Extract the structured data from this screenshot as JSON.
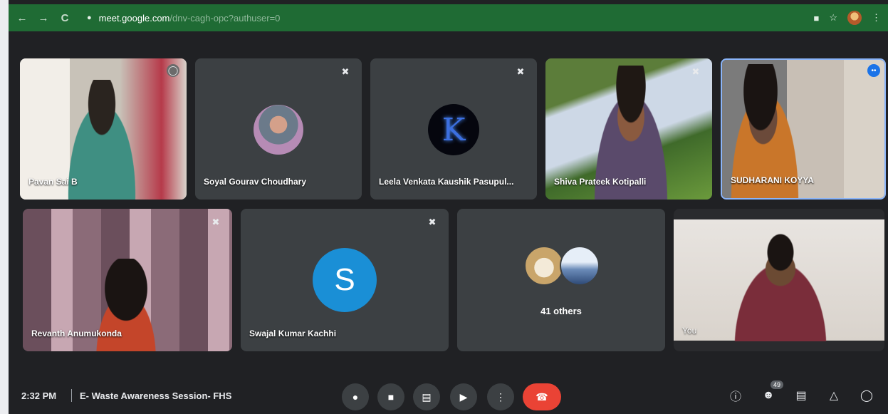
{
  "browser": {
    "back_icon": "back-arrow-icon",
    "forward_icon": "forward-arrow-icon",
    "reload_icon": "reload-icon",
    "url_host": "meet.google.com",
    "url_path": "/dnv-cagh-opc?authuser=0"
  },
  "participants": [
    {
      "name": "Pavan Sai B",
      "muted": true
    },
    {
      "name": "Soyal Gourav Choudhary",
      "muted": true
    },
    {
      "name": "Leela Venkata Kaushik Pasupul...",
      "muted": true,
      "avatar_letter": "K"
    },
    {
      "name": "Shiva Prateek Kotipalli",
      "muted": true
    },
    {
      "name": "SUDHARANI KOYYA",
      "muted": false,
      "speaking": true
    },
    {
      "name": "Revanth Anumukonda",
      "muted": true
    },
    {
      "name": "Swajal Kumar Kachhi",
      "muted": true,
      "avatar_letter": "S"
    },
    {
      "name": "41 others"
    },
    {
      "name": "You"
    }
  ],
  "bottom": {
    "time": "2:32 PM",
    "meeting_title": "E- Waste Awareness Session- FHS",
    "people_count": "49"
  },
  "colors": {
    "accent": "#1a73e8",
    "end_call": "#ea4335",
    "tile_bg": "#3c4043",
    "speaking_border": "#8ab4f8"
  }
}
